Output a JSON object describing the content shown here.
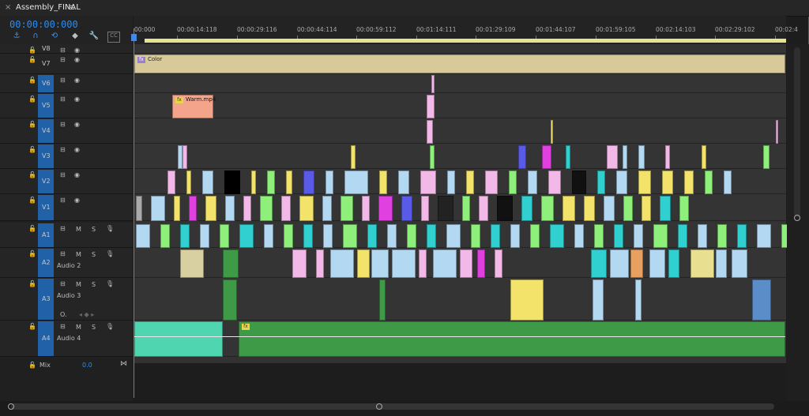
{
  "sequence": {
    "title": "Assembly_FINAL",
    "menu_glyph": "≡",
    "close_glyph": "×",
    "timecode": "00:00:00:000"
  },
  "ruler": {
    "labels": [
      "00:000",
      "00:00:14:118",
      "00:00:29:116",
      "00:00:44:114",
      "00:00:59:112",
      "00:01:14:111",
      "00:01:29:109",
      "00:01:44:107",
      "00:01:59:105",
      "00:02:14:103",
      "00:02:29:102",
      "00:02:4"
    ]
  },
  "tools": [
    {
      "name": "snap-icon",
      "glyph": "⚓"
    },
    {
      "name": "magnet-icon",
      "glyph": "∩"
    },
    {
      "name": "linked-selection-icon",
      "glyph": "⟲"
    },
    {
      "name": "marker-icon",
      "glyph": "◆"
    },
    {
      "name": "wrench-icon",
      "glyph": "🔧"
    },
    {
      "name": "captions-icon",
      "glyph": "CC"
    }
  ],
  "video_tracks": [
    {
      "id": "V8",
      "label": "V8"
    },
    {
      "id": "V7",
      "label": "V7"
    },
    {
      "id": "V6",
      "label": "V6"
    },
    {
      "id": "V5",
      "label": "V5"
    },
    {
      "id": "V4",
      "label": "V4"
    },
    {
      "id": "V3",
      "label": "V3"
    },
    {
      "id": "V2",
      "label": "V2"
    },
    {
      "id": "V1",
      "label": "V1"
    }
  ],
  "audio_tracks": [
    {
      "id": "A1",
      "label": "A1",
      "name": "",
      "m": "M",
      "s": "S"
    },
    {
      "id": "A2",
      "label": "A2",
      "name": "Audio 2",
      "m": "M",
      "s": "S"
    },
    {
      "id": "A3",
      "label": "A3",
      "name": "Audio 3",
      "m": "M",
      "s": "S"
    },
    {
      "id": "A4",
      "label": "A4",
      "name": "Audio 4",
      "m": "M",
      "s": "S"
    }
  ],
  "mix": {
    "label": "Mix",
    "value": "0.0"
  },
  "clips": {
    "color_clip_label": "Color",
    "warm_clip_label": "Warm.mp4",
    "fx_label": "fx"
  },
  "colors": {
    "accent": "#2d8ceb",
    "track_target": "#2061a8",
    "color_matte": "#d8c99a",
    "warm_clip": "#f4a48a",
    "audio4": "#3f9a48",
    "audio4_start": "#4fd6b0"
  }
}
